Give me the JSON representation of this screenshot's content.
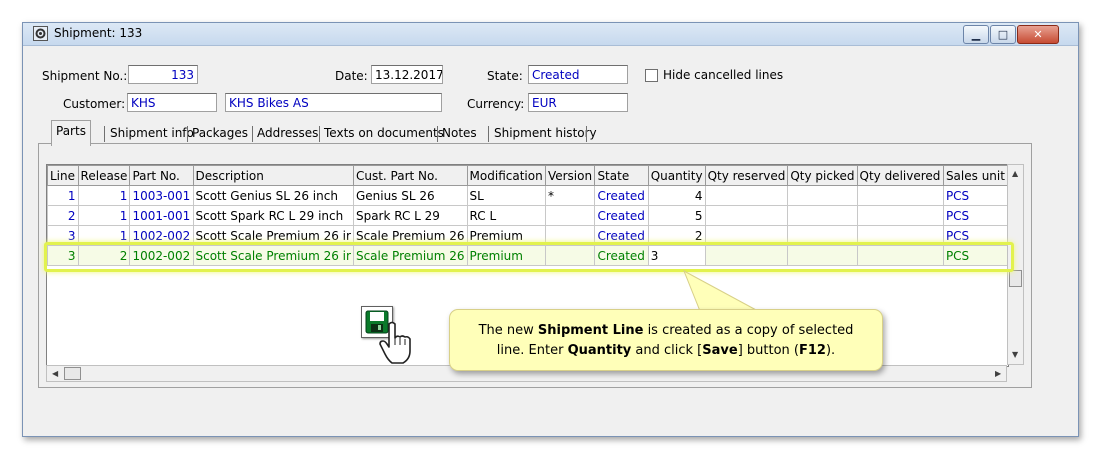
{
  "window": {
    "title": "Shipment: 133"
  },
  "header": {
    "shipment_no_label": "Shipment No.:",
    "shipment_no": "133",
    "date_label": "Date:",
    "date": "13.12.2017",
    "state_label": "State:",
    "state": "Created",
    "hide_cancelled_label": "Hide cancelled lines",
    "customer_label": "Customer:",
    "customer_code": "KHS",
    "customer_name": "KHS Bikes AS",
    "currency_label": "Currency:",
    "currency": "EUR"
  },
  "tabs": [
    "Parts",
    "Shipment info",
    "Packages",
    "Addresses",
    "Texts on documents",
    "Notes",
    "Shipment history"
  ],
  "grid": {
    "columns": [
      "Line",
      "Release",
      "Part No.",
      "Description",
      "Cust. Part No.",
      "Modification",
      "Version",
      "State",
      "Quantity",
      "Qty reserved",
      "Qty picked",
      "Qty delivered",
      "Sales unit"
    ],
    "rows": [
      [
        "1",
        "1",
        "1003-001",
        "Scott Genius SL 26 inch",
        "Genius SL 26",
        "SL",
        "*",
        "Created",
        "4",
        "",
        "",
        "",
        "PCS"
      ],
      [
        "2",
        "1",
        "1001-001",
        "Scott Spark RC L 29 inch",
        "Spark RC L 29",
        "RC L",
        "",
        "Created",
        "5",
        "",
        "",
        "",
        "PCS"
      ],
      [
        "3",
        "1",
        "1002-002",
        "Scott Scale Premium 26 ir",
        "Scale Premium 26",
        "Premium",
        "",
        "Created",
        "2",
        "",
        "",
        "",
        "PCS"
      ],
      [
        "3",
        "2",
        "1002-002",
        "Scott Scale Premium 26 ir",
        "Scale Premium 26",
        "Premium",
        "",
        "Created",
        "3",
        "",
        "",
        "",
        "PCS"
      ]
    ]
  },
  "callout": {
    "t1": "The new ",
    "b1": "Shipment Line",
    "t2": " is created as a copy of selected",
    "t3": "line. Enter ",
    "b2": "Quantity",
    "t4": " and click [",
    "b3": "Save",
    "t5": "] button (",
    "b4": "F12",
    "t6": ")."
  },
  "icons": {
    "save": "save-icon",
    "pointer": "hand-pointer-icon"
  },
  "colors": {
    "link_blue": "#0000c0",
    "new_row_green": "#008000",
    "highlight": "#e2f24d",
    "callout_bg": "#ffffb9"
  }
}
